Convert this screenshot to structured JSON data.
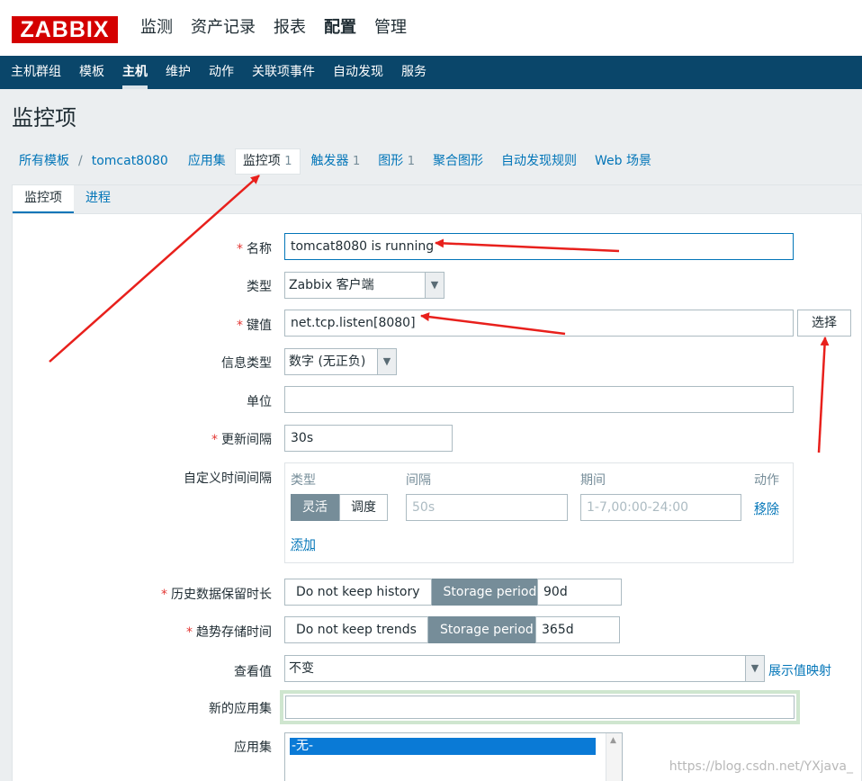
{
  "logo": "ZABBIX",
  "main_menu": [
    "监测",
    "资产记录",
    "报表",
    "配置",
    "管理"
  ],
  "main_menu_active": "配置",
  "sub_menu": [
    "主机群组",
    "模板",
    "主机",
    "维护",
    "动作",
    "关联项事件",
    "自动发现",
    "服务"
  ],
  "sub_menu_active": "主机",
  "page_title": "监控项",
  "breadcrumbs": {
    "all_templates": "所有模板",
    "separator": "/",
    "host": "tomcat8080",
    "applications": "应用集",
    "items": "监控项",
    "items_count": "1",
    "triggers": "触发器",
    "triggers_count": "1",
    "graphs": "图形",
    "graphs_count": "1",
    "screens": "聚合图形",
    "discovery": "自动发现规则",
    "web": "Web 场景"
  },
  "tabs": [
    "监控项",
    "进程"
  ],
  "form": {
    "name_label": "名称",
    "name_value": "tomcat8080 is running",
    "type_label": "类型",
    "type_value": "Zabbix 客户端",
    "key_label": "键值",
    "key_value": "net.tcp.listen[8080]",
    "key_select_button": "选择",
    "info_type_label": "信息类型",
    "info_type_value": "数字 (无正负)",
    "units_label": "单位",
    "units_value": "",
    "interval_label": "更新间隔",
    "interval_value": "30s",
    "custom_intervals_label": "自定义时间间隔",
    "custom_intervals": {
      "col_type": "类型",
      "col_interval": "间隔",
      "col_period": "期间",
      "col_action": "动作",
      "flexible": "灵活",
      "scheduling": "调度",
      "interval_placeholder": "50s",
      "period_placeholder": "1-7,00:00-24:00",
      "remove": "移除",
      "add": "添加"
    },
    "history_label": "历史数据保留时长",
    "history_no_keep": "Do not keep history",
    "history_storage": "Storage period",
    "history_value": "90d",
    "trends_label": "趋势存储时间",
    "trends_no_keep": "Do not keep trends",
    "trends_storage": "Storage period",
    "trends_value": "365d",
    "show_value_label": "查看值",
    "show_value_value": "不变",
    "show_value_mapping_link": "展示值映射",
    "new_application_label": "新的应用集",
    "new_application_value": "",
    "applications_label": "应用集",
    "applications_selected": "-无-"
  },
  "watermark": "https://blog.csdn.net/YXjava_",
  "colors": {
    "logo_red": "#d40000",
    "nav_blue": "#0a466a",
    "link_blue": "#0275b8",
    "annotation_red": "#e8201c"
  }
}
